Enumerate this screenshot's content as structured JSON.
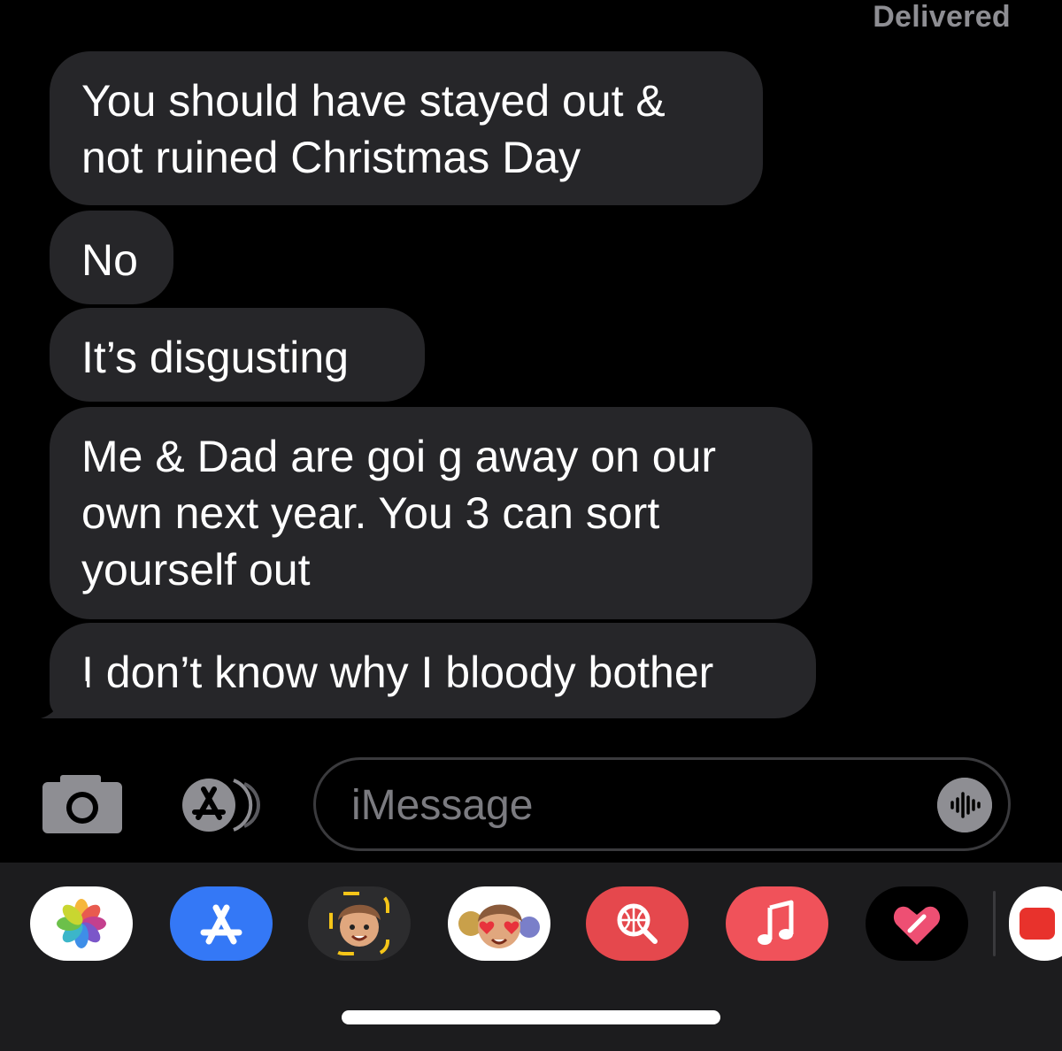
{
  "status": {
    "delivered_label": "Delivered"
  },
  "messages": [
    "You should have stayed out & not ruined Christmas Day",
    "No",
    "It’s disgusting",
    "Me & Dad are goi g away on our own next year. You 3 can sort yourself out",
    "I don’t know why I bloody bother"
  ],
  "compose": {
    "placeholder": "iMessage"
  },
  "drawer": {
    "apps": [
      "photos-icon",
      "app-store-icon",
      "memoji-icon",
      "memoji-stickers-icon",
      "web-search-icon",
      "music-icon",
      "digital-touch-icon",
      "more-app-icon"
    ]
  },
  "colors": {
    "bubble": "#262629",
    "status": "#8e8e93",
    "drawer": "#1c1c1e",
    "accent_red": "#e5484d",
    "accent_blue": "#3478f6"
  }
}
